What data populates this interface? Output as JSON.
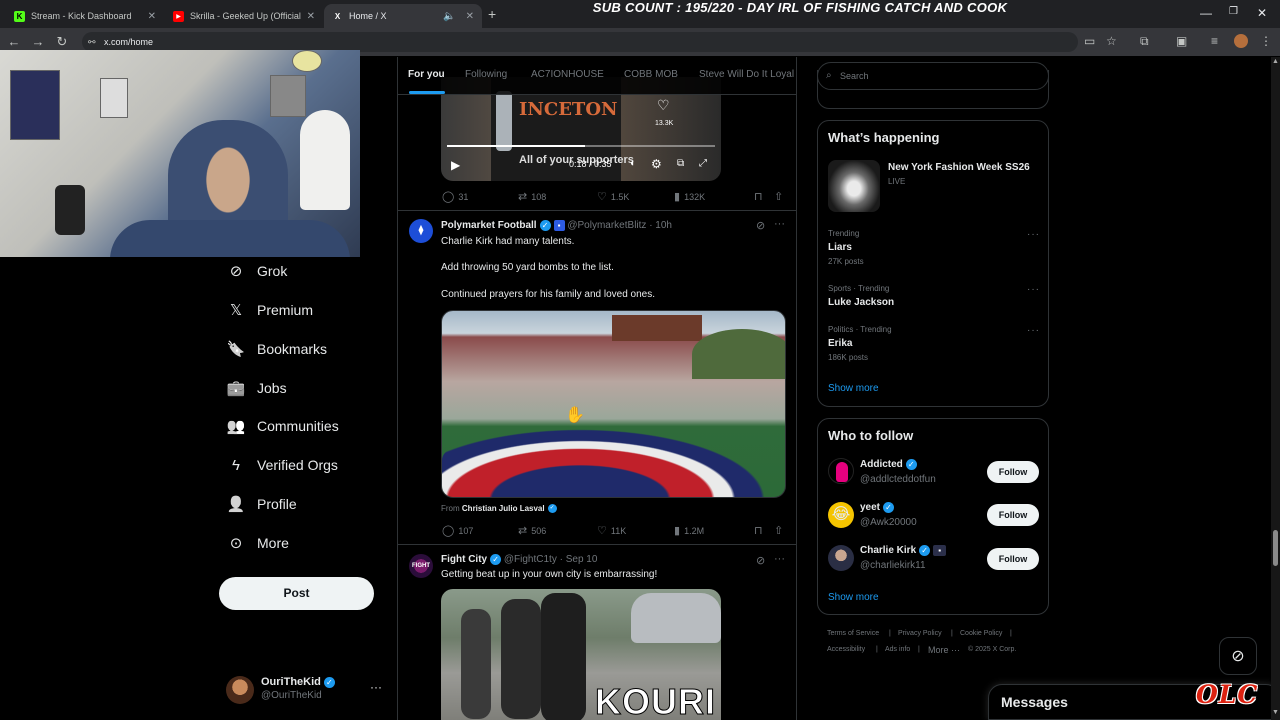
{
  "browser": {
    "tabs": [
      {
        "label": "Stream - Kick Dashboard",
        "favicon": "K",
        "color": "#53fc18"
      },
      {
        "label": "Skrilla - Geeked Up (Official Vid",
        "favicon": "▶",
        "color": "#ff0000"
      },
      {
        "label": "Home / X",
        "favicon": "X",
        "color": "#ffffff"
      }
    ],
    "new_tab": "+",
    "url": "x.com/home"
  },
  "overlay": {
    "title": "SUB COUNT : 195/220 - DAY IRL OF FISHING CATCH AND COOK",
    "watermark": "OLC"
  },
  "sidebar": {
    "items": [
      {
        "label": "Grok",
        "icon": "grok-icon",
        "glyph": "⊘"
      },
      {
        "label": "Premium",
        "icon": "x-logo-icon",
        "glyph": "𝕏"
      },
      {
        "label": "Bookmarks",
        "icon": "bookmark-icon",
        "glyph": "🔖"
      },
      {
        "label": "Jobs",
        "icon": "briefcase-icon",
        "glyph": "💼"
      },
      {
        "label": "Communities",
        "icon": "people-icon",
        "glyph": "👥"
      },
      {
        "label": "Verified Orgs",
        "icon": "lightning-icon",
        "glyph": "ϟ"
      },
      {
        "label": "Profile",
        "icon": "person-icon",
        "glyph": "👤"
      },
      {
        "label": "More",
        "icon": "more-circle-icon",
        "glyph": "⊙"
      }
    ],
    "post_label": "Post",
    "account": {
      "name": "OuriTheKid",
      "handle": "@OuriTheKid"
    }
  },
  "feed": {
    "tabs": [
      "For you",
      "Following",
      "AC7IONHOUSE",
      "COBB MOB",
      "Steve Will Do It Loyal"
    ],
    "video": {
      "caption": "All of your supporters",
      "time": "0:18 / 0:35",
      "likes": "13.3K",
      "shirt_text": "INCETON"
    },
    "tweet0_stats": {
      "replies": "31",
      "reposts": "108",
      "likes": "1.5K",
      "views": "132K"
    },
    "tweet1": {
      "name": "Polymarket Football",
      "handle": "@PolymarketBlitz",
      "time": "· 10h",
      "lines": [
        "Charlie Kirk had many talents.",
        "Add throwing 50 yard bombs to the list.",
        "Continued prayers for his family and loved ones."
      ],
      "from_label": "From",
      "from_name": "Christian Julio Lasval",
      "stats": {
        "replies": "107",
        "reposts": "506",
        "likes": "11K",
        "views": "1.2M"
      }
    },
    "tweet2": {
      "name": "Fight City",
      "handle": "@FightC1ty",
      "time": "· Sep 10",
      "text": "Getting beat up in your own city is embarrassing!",
      "overlay_text": "KOURI"
    }
  },
  "right": {
    "search_placeholder": "Search",
    "whats_happening": {
      "title": "What’s happening",
      "event": {
        "name": "New York Fashion Week SS26",
        "status": "LIVE"
      },
      "trends": [
        {
          "category": "Trending",
          "name": "Liars",
          "count": "27K posts"
        },
        {
          "category": "Sports · Trending",
          "name": "Luke Jackson",
          "count": ""
        },
        {
          "category": "Politics · Trending",
          "name": "Erika",
          "count": "186K posts"
        }
      ],
      "show_more": "Show more"
    },
    "who_to_follow": {
      "title": "Who to follow",
      "users": [
        {
          "name": "Addicted",
          "handle": "@addlcteddotfun",
          "button": "Follow",
          "color": "#e6007e"
        },
        {
          "name": "yeet",
          "handle": "@Awk20000",
          "button": "Follow",
          "color": "#f5c400"
        },
        {
          "name": "Charlie Kirk",
          "handle": "@charliekirk11",
          "button": "Follow",
          "color": "#3a3f55"
        }
      ],
      "show_more": "Show more"
    },
    "footer": [
      "Terms of Service",
      "Privacy Policy",
      "Cookie Policy",
      "Accessibility",
      "Ads info",
      "More ···",
      "© 2025 X Corp."
    ],
    "messages_label": "Messages"
  }
}
